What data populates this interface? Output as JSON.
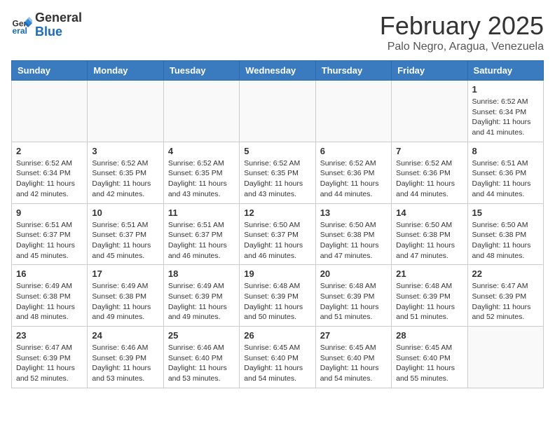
{
  "logo": {
    "general": "General",
    "blue": "Blue"
  },
  "header": {
    "month": "February 2025",
    "location": "Palo Negro, Aragua, Venezuela"
  },
  "weekdays": [
    "Sunday",
    "Monday",
    "Tuesday",
    "Wednesday",
    "Thursday",
    "Friday",
    "Saturday"
  ],
  "weeks": [
    [
      {
        "day": "",
        "info": ""
      },
      {
        "day": "",
        "info": ""
      },
      {
        "day": "",
        "info": ""
      },
      {
        "day": "",
        "info": ""
      },
      {
        "day": "",
        "info": ""
      },
      {
        "day": "",
        "info": ""
      },
      {
        "day": "1",
        "info": "Sunrise: 6:52 AM\nSunset: 6:34 PM\nDaylight: 11 hours\nand 41 minutes."
      }
    ],
    [
      {
        "day": "2",
        "info": "Sunrise: 6:52 AM\nSunset: 6:34 PM\nDaylight: 11 hours\nand 42 minutes."
      },
      {
        "day": "3",
        "info": "Sunrise: 6:52 AM\nSunset: 6:35 PM\nDaylight: 11 hours\nand 42 minutes."
      },
      {
        "day": "4",
        "info": "Sunrise: 6:52 AM\nSunset: 6:35 PM\nDaylight: 11 hours\nand 43 minutes."
      },
      {
        "day": "5",
        "info": "Sunrise: 6:52 AM\nSunset: 6:35 PM\nDaylight: 11 hours\nand 43 minutes."
      },
      {
        "day": "6",
        "info": "Sunrise: 6:52 AM\nSunset: 6:36 PM\nDaylight: 11 hours\nand 44 minutes."
      },
      {
        "day": "7",
        "info": "Sunrise: 6:52 AM\nSunset: 6:36 PM\nDaylight: 11 hours\nand 44 minutes."
      },
      {
        "day": "8",
        "info": "Sunrise: 6:51 AM\nSunset: 6:36 PM\nDaylight: 11 hours\nand 44 minutes."
      }
    ],
    [
      {
        "day": "9",
        "info": "Sunrise: 6:51 AM\nSunset: 6:37 PM\nDaylight: 11 hours\nand 45 minutes."
      },
      {
        "day": "10",
        "info": "Sunrise: 6:51 AM\nSunset: 6:37 PM\nDaylight: 11 hours\nand 45 minutes."
      },
      {
        "day": "11",
        "info": "Sunrise: 6:51 AM\nSunset: 6:37 PM\nDaylight: 11 hours\nand 46 minutes."
      },
      {
        "day": "12",
        "info": "Sunrise: 6:50 AM\nSunset: 6:37 PM\nDaylight: 11 hours\nand 46 minutes."
      },
      {
        "day": "13",
        "info": "Sunrise: 6:50 AM\nSunset: 6:38 PM\nDaylight: 11 hours\nand 47 minutes."
      },
      {
        "day": "14",
        "info": "Sunrise: 6:50 AM\nSunset: 6:38 PM\nDaylight: 11 hours\nand 47 minutes."
      },
      {
        "day": "15",
        "info": "Sunrise: 6:50 AM\nSunset: 6:38 PM\nDaylight: 11 hours\nand 48 minutes."
      }
    ],
    [
      {
        "day": "16",
        "info": "Sunrise: 6:49 AM\nSunset: 6:38 PM\nDaylight: 11 hours\nand 48 minutes."
      },
      {
        "day": "17",
        "info": "Sunrise: 6:49 AM\nSunset: 6:38 PM\nDaylight: 11 hours\nand 49 minutes."
      },
      {
        "day": "18",
        "info": "Sunrise: 6:49 AM\nSunset: 6:39 PM\nDaylight: 11 hours\nand 49 minutes."
      },
      {
        "day": "19",
        "info": "Sunrise: 6:48 AM\nSunset: 6:39 PM\nDaylight: 11 hours\nand 50 minutes."
      },
      {
        "day": "20",
        "info": "Sunrise: 6:48 AM\nSunset: 6:39 PM\nDaylight: 11 hours\nand 51 minutes."
      },
      {
        "day": "21",
        "info": "Sunrise: 6:48 AM\nSunset: 6:39 PM\nDaylight: 11 hours\nand 51 minutes."
      },
      {
        "day": "22",
        "info": "Sunrise: 6:47 AM\nSunset: 6:39 PM\nDaylight: 11 hours\nand 52 minutes."
      }
    ],
    [
      {
        "day": "23",
        "info": "Sunrise: 6:47 AM\nSunset: 6:39 PM\nDaylight: 11 hours\nand 52 minutes."
      },
      {
        "day": "24",
        "info": "Sunrise: 6:46 AM\nSunset: 6:39 PM\nDaylight: 11 hours\nand 53 minutes."
      },
      {
        "day": "25",
        "info": "Sunrise: 6:46 AM\nSunset: 6:40 PM\nDaylight: 11 hours\nand 53 minutes."
      },
      {
        "day": "26",
        "info": "Sunrise: 6:45 AM\nSunset: 6:40 PM\nDaylight: 11 hours\nand 54 minutes."
      },
      {
        "day": "27",
        "info": "Sunrise: 6:45 AM\nSunset: 6:40 PM\nDaylight: 11 hours\nand 54 minutes."
      },
      {
        "day": "28",
        "info": "Sunrise: 6:45 AM\nSunset: 6:40 PM\nDaylight: 11 hours\nand 55 minutes."
      },
      {
        "day": "",
        "info": ""
      }
    ]
  ]
}
